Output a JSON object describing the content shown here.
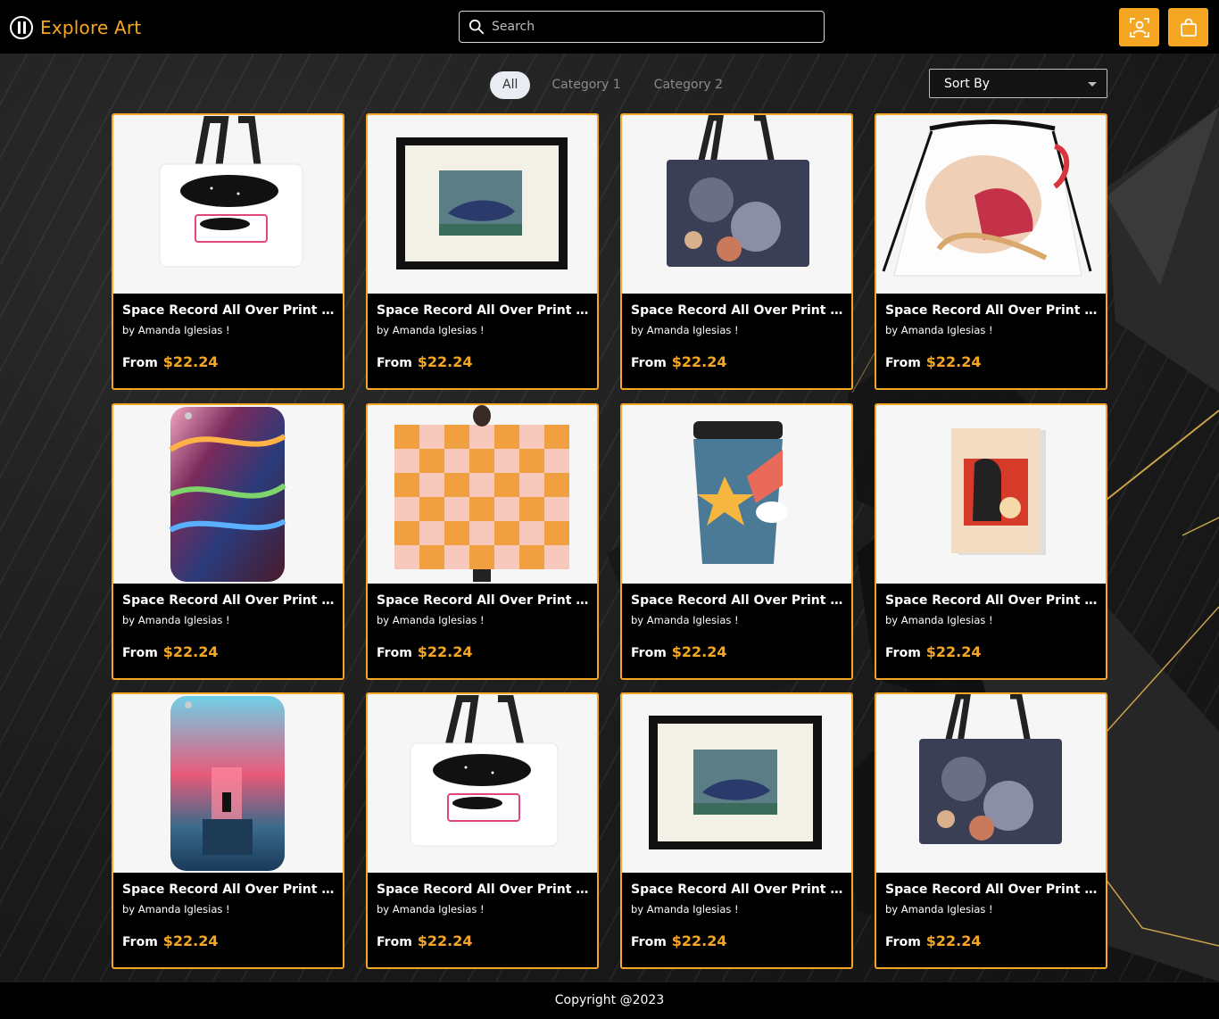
{
  "header": {
    "brand": "Explore Art",
    "search_placeholder": "Search"
  },
  "filters": {
    "tabs": [
      {
        "label": "All",
        "active": true
      },
      {
        "label": "Category 1",
        "active": false
      },
      {
        "label": "Category 2",
        "active": false
      }
    ],
    "sort_label": "Sort By"
  },
  "colors": {
    "accent": "#f5a623",
    "header_bg": "#000000",
    "page_bg": "#1b1b1b"
  },
  "products": [
    {
      "title": "Space Record All Over Print Tote Bag",
      "author": "by Amanda Iglesias !",
      "from": "From",
      "price": "$22.24",
      "image": "tote-bag-record"
    },
    {
      "title": "Space Record All Over Print Tote Bag",
      "author": "by Amanda Iglesias !",
      "from": "From",
      "price": "$22.24",
      "image": "framed-print-whale"
    },
    {
      "title": "Space Record All Over Print Tote Bag",
      "author": "by Amanda Iglesias !",
      "from": "From",
      "price": "$22.24",
      "image": "tote-bag-dark-floral"
    },
    {
      "title": "Space Record All Over Print Tote Bag",
      "author": "by Amanda Iglesias !",
      "from": "From",
      "price": "$22.24",
      "image": "drawstring-bag"
    },
    {
      "title": "Space Record All Over Print Tote Bag",
      "author": "by Amanda Iglesias !",
      "from": "From",
      "price": "$22.24",
      "image": "phone-case-rainbow"
    },
    {
      "title": "Space Record All Over Print Tote Bag",
      "author": "by Amanda Iglesias !",
      "from": "From",
      "price": "$22.24",
      "image": "blanket-suns"
    },
    {
      "title": "Space Record All Over Print Tote Bag",
      "author": "by Amanda Iglesias !",
      "from": "From",
      "price": "$22.24",
      "image": "travel-mug-star"
    },
    {
      "title": "Space Record All Over Print Tote Bag",
      "author": "by Amanda Iglesias !",
      "from": "From",
      "price": "$22.24",
      "image": "greeting-card"
    },
    {
      "title": "Space Record All Over Print Tote Bag",
      "author": "by Amanda Iglesias !",
      "from": "From",
      "price": "$22.24",
      "image": "phone-case-exit"
    },
    {
      "title": "Space Record All Over Print Tote Bag",
      "author": "by Amanda Iglesias !",
      "from": "From",
      "price": "$22.24",
      "image": "tote-bag-record"
    },
    {
      "title": "Space Record All Over Print Tote Bag",
      "author": "by Amanda Iglesias !",
      "from": "From",
      "price": "$22.24",
      "image": "framed-print-whale"
    },
    {
      "title": "Space Record All Over Print Tote Bag",
      "author": "by Amanda Iglesias !",
      "from": "From",
      "price": "$22.24",
      "image": "tote-bag-dark-floral"
    }
  ],
  "footer": {
    "copyright": "Copyright @2023"
  }
}
